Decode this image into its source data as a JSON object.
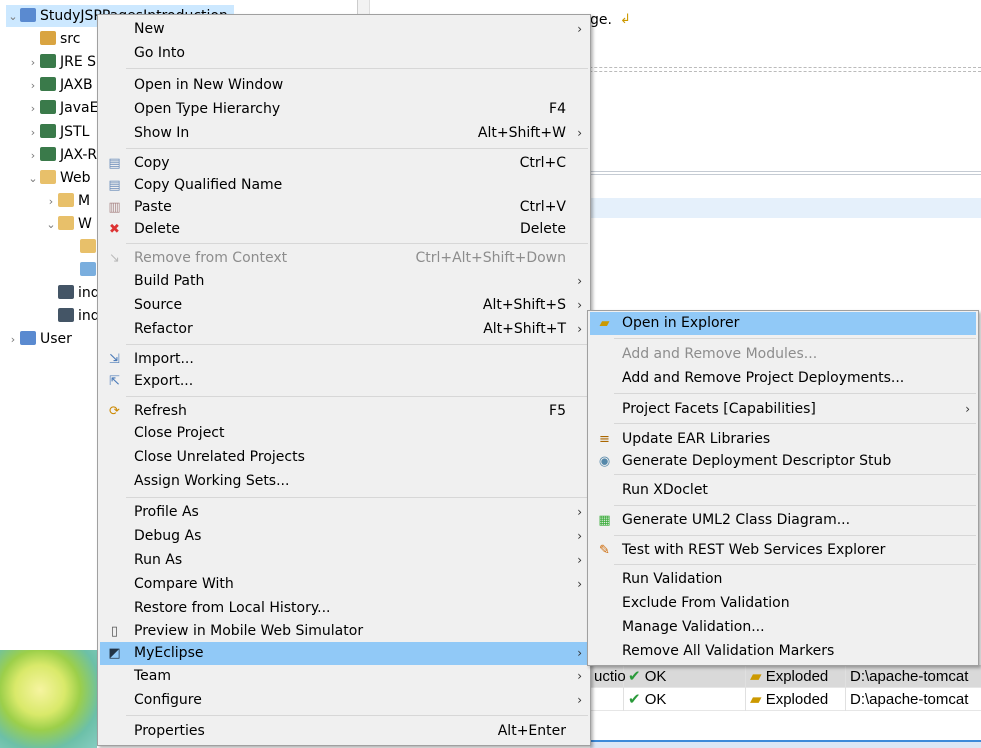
{
  "tree": {
    "items": [
      {
        "label": "StudyJSPPagesIntroduction",
        "twisty": "v",
        "icon": "project-icon",
        "selected": true
      },
      {
        "label": "src",
        "twisty": "",
        "icon": "package-folder-icon"
      },
      {
        "label": "JRE S",
        "twisty": ">",
        "icon": "library-icon"
      },
      {
        "label": "JAXB",
        "twisty": ">",
        "icon": "library-icon"
      },
      {
        "label": "JavaE",
        "twisty": ">",
        "icon": "library-icon"
      },
      {
        "label": "JSTL",
        "twisty": ">",
        "icon": "library-icon"
      },
      {
        "label": "JAX-R",
        "twisty": ">",
        "icon": "library-icon"
      },
      {
        "label": "Web",
        "twisty": "v",
        "icon": "folder-icon"
      },
      {
        "label": "M",
        "twisty": ">",
        "icon": "folder-icon"
      },
      {
        "label": "W",
        "twisty": "v",
        "icon": "folder-icon"
      },
      {
        "label": "",
        "twisty": "",
        "icon": "folder-icon"
      },
      {
        "label": "",
        "twisty": "",
        "icon": "web-xml-icon"
      },
      {
        "label": "ind",
        "twisty": "",
        "icon": "jsp-file-icon"
      },
      {
        "label": "ind",
        "twisty": "",
        "icon": "jsp-file-icon"
      },
      {
        "label": "User",
        "twisty": ">",
        "icon": "project-icon"
      }
    ]
  },
  "editor": {
    "text": "ge."
  },
  "context_menu": {
    "items": [
      {
        "label": "New",
        "arrow": true
      },
      {
        "label": "Go Into"
      },
      {
        "sep": true
      },
      {
        "label": "Open in New Window"
      },
      {
        "label": "Open Type Hierarchy",
        "shortcut": "F4"
      },
      {
        "label": "Show In",
        "shortcut": "Alt+Shift+W",
        "arrow": true
      },
      {
        "sep": true
      },
      {
        "label": "Copy",
        "shortcut": "Ctrl+C",
        "icon": "copy-icon"
      },
      {
        "label": "Copy Qualified Name",
        "icon": "copy-qualified-icon"
      },
      {
        "label": "Paste",
        "shortcut": "Ctrl+V",
        "icon": "paste-icon"
      },
      {
        "label": "Delete",
        "shortcut": "Delete",
        "icon": "delete-icon"
      },
      {
        "sep": true
      },
      {
        "label": "Remove from Context",
        "shortcut": "Ctrl+Alt+Shift+Down",
        "disabled": true,
        "icon": "remove-context-icon"
      },
      {
        "label": "Build Path",
        "arrow": true
      },
      {
        "label": "Source",
        "shortcut": "Alt+Shift+S",
        "arrow": true
      },
      {
        "label": "Refactor",
        "shortcut": "Alt+Shift+T",
        "arrow": true
      },
      {
        "sep": true
      },
      {
        "label": "Import...",
        "icon": "import-icon"
      },
      {
        "label": "Export...",
        "icon": "export-icon"
      },
      {
        "sep": true
      },
      {
        "label": "Refresh",
        "shortcut": "F5",
        "icon": "refresh-icon"
      },
      {
        "label": "Close Project"
      },
      {
        "label": "Close Unrelated Projects"
      },
      {
        "label": "Assign Working Sets..."
      },
      {
        "sep": true
      },
      {
        "label": "Profile As",
        "arrow": true
      },
      {
        "label": "Debug As",
        "arrow": true
      },
      {
        "label": "Run As",
        "arrow": true
      },
      {
        "label": "Compare With",
        "arrow": true
      },
      {
        "label": "Restore from Local History..."
      },
      {
        "label": "Preview in Mobile Web Simulator",
        "icon": "mobile-icon"
      },
      {
        "label": "MyEclipse",
        "arrow": true,
        "highlighted": true,
        "icon": "myeclipse-icon"
      },
      {
        "label": "Team",
        "arrow": true
      },
      {
        "label": "Configure",
        "arrow": true
      },
      {
        "sep": true
      },
      {
        "label": "Properties",
        "shortcut": "Alt+Enter"
      }
    ]
  },
  "submenu": {
    "items": [
      {
        "label": "Open in Explorer",
        "highlighted": true,
        "icon": "open-folder-icon"
      },
      {
        "sep": true
      },
      {
        "label": "Add and Remove Modules...",
        "disabled": true
      },
      {
        "label": "Add and Remove Project Deployments..."
      },
      {
        "sep": true
      },
      {
        "label": "Project Facets [Capabilities]",
        "arrow": true
      },
      {
        "sep": true
      },
      {
        "label": "Update EAR Libraries",
        "icon": "library-icon"
      },
      {
        "label": "Generate Deployment Descriptor Stub",
        "icon": "descriptor-icon"
      },
      {
        "sep": true
      },
      {
        "label": "Run XDoclet"
      },
      {
        "sep": true
      },
      {
        "label": "Generate UML2 Class Diagram...",
        "icon": "uml-icon"
      },
      {
        "sep": true
      },
      {
        "label": "Test with REST Web Services Explorer",
        "icon": "rest-icon"
      },
      {
        "sep": true
      },
      {
        "label": "Run Validation"
      },
      {
        "label": "Exclude From Validation"
      },
      {
        "label": "Manage Validation..."
      },
      {
        "label": "Remove All Validation Markers"
      }
    ]
  },
  "deployments": {
    "rows": [
      {
        "project": "uctio",
        "status": "OK",
        "type": "Exploded",
        "location": "D:\\apache-tomcat"
      },
      {
        "project": "",
        "status": "OK",
        "type": "Exploded",
        "location": "D:\\apache-tomcat"
      }
    ]
  },
  "colors": {
    "highlight": "#91c9f7",
    "menu_bg": "#f0f0f0",
    "selection": "#cce8ff"
  }
}
